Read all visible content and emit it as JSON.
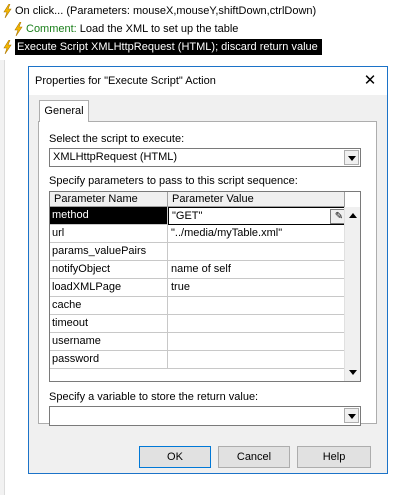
{
  "script_list": {
    "line1": "On click... (Parameters: mouseX,mouseY,shiftDown,ctrlDown)",
    "line2_keyword": "Comment:",
    "line2_text": " Load the XML to set up the table",
    "line3": "Execute Script XMLHttpRequest (HTML); discard return value"
  },
  "dialog": {
    "title": "Properties for \"Execute Script\" Action",
    "close_glyph": "✕",
    "tab_general": "General",
    "script_label": "Select the script to execute:",
    "script_value": "XMLHttpRequest (HTML)",
    "params_label": "Specify parameters to pass to this script sequence:",
    "grid": {
      "headers": [
        "Parameter Name",
        "Parameter Value"
      ],
      "rows": [
        {
          "name": "method",
          "value": "\"GET\""
        },
        {
          "name": "url",
          "value": "\"../media/myTable.xml\""
        },
        {
          "name": "params_valuePairs",
          "value": ""
        },
        {
          "name": "notifyObject",
          "value": "name of self"
        },
        {
          "name": "loadXMLPage",
          "value": "true"
        },
        {
          "name": "cache",
          "value": ""
        },
        {
          "name": "timeout",
          "value": ""
        },
        {
          "name": "username",
          "value": ""
        },
        {
          "name": "password",
          "value": ""
        }
      ],
      "selected_row": "method"
    },
    "return_label": "Specify a variable to store the return value:",
    "return_value": "",
    "buttons": {
      "ok": "OK",
      "cancel": "Cancel",
      "help": "Help"
    }
  },
  "colors": {
    "title_border": "#1c73c8",
    "comment_green": "#1a7f1a",
    "bolt": "#f5b800"
  },
  "icons": [
    "lightning-bolt-icon",
    "close-icon",
    "edit-pencil-icon",
    "dropdown-arrow-icon",
    "scroll-up-icon",
    "scroll-down-icon"
  ]
}
